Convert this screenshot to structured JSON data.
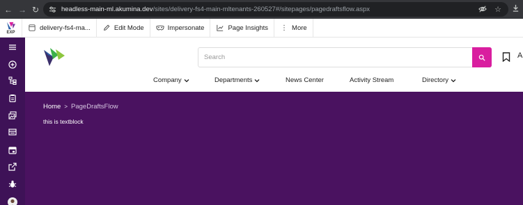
{
  "browser": {
    "url_host": "headless-main-ml.akumina.dev",
    "url_path": "/sites/delivery-fs4-main-mltenants-260527#/sitepages/pagedraftsflow.aspx"
  },
  "toolbar": {
    "exp_label": "EXP",
    "site_label": "delivery-fs4-ma...",
    "edit_mode_label": "Edit Mode",
    "impersonate_label": "Impersonate",
    "page_insights_label": "Page Insights",
    "more_label": "More"
  },
  "sidebar": {
    "items": [
      "menu",
      "add",
      "sitemap",
      "clipboard",
      "images",
      "layout",
      "calendar",
      "external-link",
      "bug",
      "avatar"
    ]
  },
  "header": {
    "search_placeholder": "Search",
    "nav": [
      {
        "label": "Company",
        "has_dropdown": true
      },
      {
        "label": "Departments",
        "has_dropdown": true
      },
      {
        "label": "News Center",
        "has_dropdown": false
      },
      {
        "label": "Activity Stream",
        "has_dropdown": false
      },
      {
        "label": "Directory",
        "has_dropdown": true
      }
    ],
    "edge_text": "A"
  },
  "content": {
    "breadcrumb_home": "Home",
    "breadcrumb_sep": ">",
    "breadcrumb_current": "PageDraftsFlow",
    "textblock": "this is textblock"
  },
  "colors": {
    "chrome": "#35363a",
    "sidebar": "#3e1257",
    "content_bg": "#4a1260",
    "search_button": "#d91e9f"
  }
}
